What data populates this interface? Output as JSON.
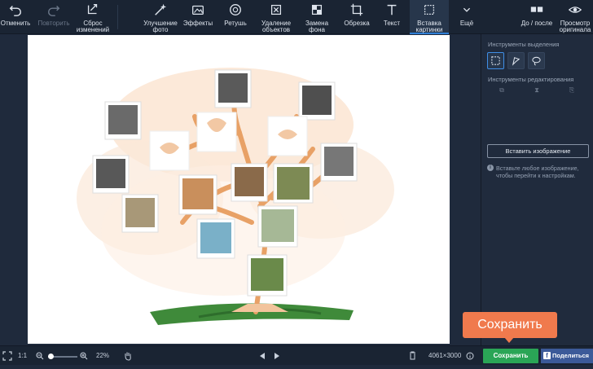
{
  "toolbar": {
    "undo": "Отменить",
    "redo": "Повторить",
    "reset": "Сброс\nизменений",
    "enhance": "Улучшение\nфото",
    "effects": "Эффекты",
    "retouch": "Ретушь",
    "remove_objects": "Удаление\nобъектов",
    "replace_bg": "Замена\nфона",
    "crop": "Обрезка",
    "text": "Текст",
    "insert_image": "Вставка\nкартинки",
    "more": "Ещё",
    "before_after": "До / после",
    "view_original": "Просмотр\nоригинала"
  },
  "panel": {
    "selection_tools_title": "Инструменты выделения",
    "edit_tools_title": "Инструменты редактирования",
    "insert_button": "Вставить изображение",
    "hint": "Вставьте любое изображение, чтобы перейти к настройкам."
  },
  "statusbar": {
    "ratio": "1:1",
    "zoom_level": "22%",
    "zoom_fraction": 0.0,
    "image_size": "4061×3000",
    "save": "Сохранить",
    "share": "Поделиться"
  },
  "tooltip": {
    "text": "Сохранить"
  },
  "colors": {
    "accent": "#2f7fd6",
    "save_green": "#2aa556",
    "tooltip_orange": "#f07a4d",
    "facebook_blue": "#3c5a99"
  },
  "icons": [
    "undo-icon",
    "redo-icon",
    "reset-icon",
    "enhance-icon",
    "effects-icon",
    "retouch-icon",
    "remove-objects-icon",
    "replace-bg-icon",
    "crop-icon",
    "text-icon",
    "insert-image-icon",
    "chevron-down-icon",
    "before-after-icon",
    "eye-icon",
    "rect-select-icon",
    "lasso-icon",
    "magic-lasso-icon",
    "info-icon",
    "fullscreen-icon",
    "zoom-out-icon",
    "zoom-in-icon",
    "hand-icon",
    "prev-icon",
    "next-icon",
    "trash-icon"
  ]
}
